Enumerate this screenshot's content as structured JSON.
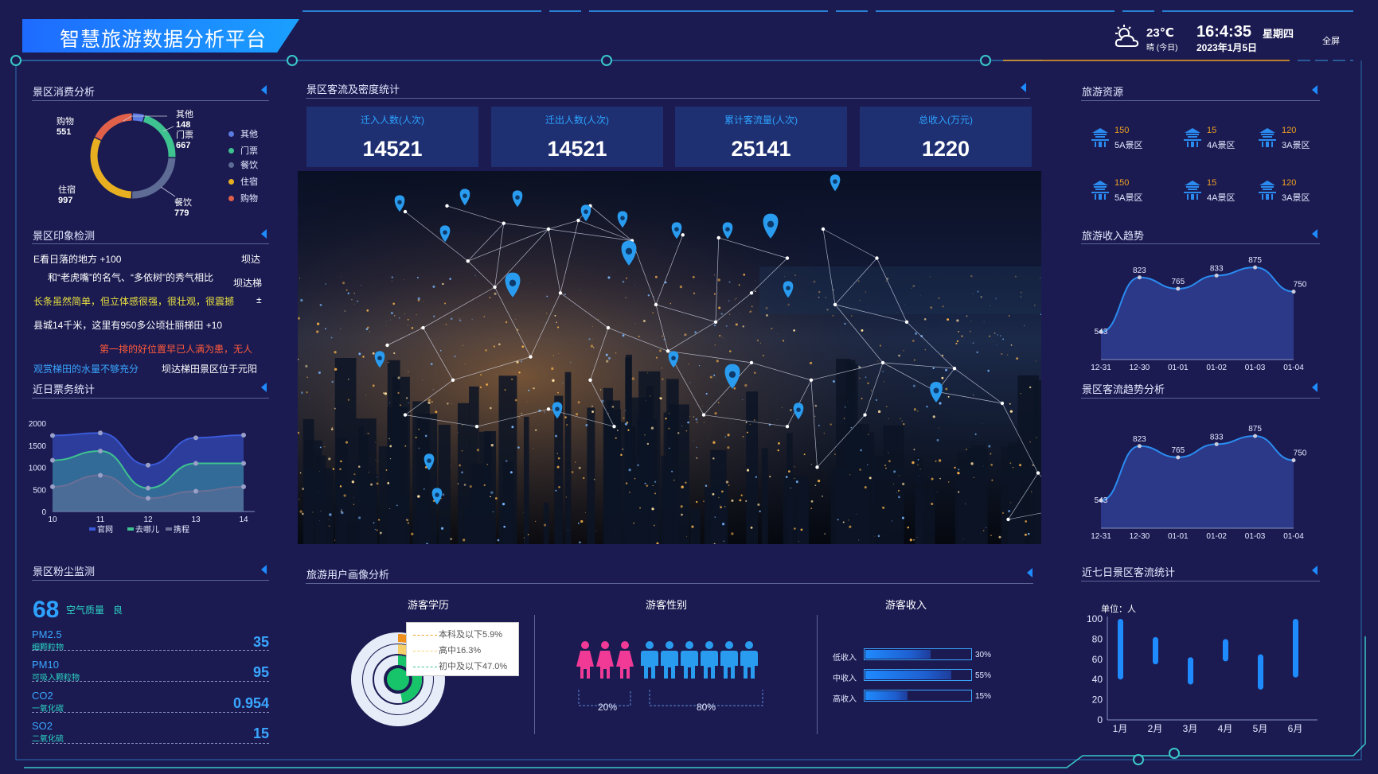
{
  "header": {
    "title": "智慧旅游数据分析平台",
    "temperature": "23℃",
    "weather_desc": "晴 (今日)",
    "time": "16:4:35",
    "weekday": "星期四",
    "date": "2023年1月5日",
    "fullscreen_label": "全屏"
  },
  "sections": {
    "consumption": "景区消费分析",
    "impression": "景区印象检测",
    "tickets": "近日票务统计",
    "dust": "景区粉尘监测",
    "flow_density": "景区客流及密度统计",
    "portrait": "旅游用户画像分析",
    "resources": "旅游资源",
    "income_trend": "旅游收入趋势",
    "flow_trend": "景区客流趋势分析",
    "seven_day": "近七日景区客流统计"
  },
  "consumption": {
    "legend": [
      {
        "name": "其他",
        "value": "148",
        "color": "#5b7be0"
      },
      {
        "name": "门票",
        "value": "667",
        "color": "#3ec28f"
      },
      {
        "name": "餐饮",
        "value": "779",
        "color": "#5e6b94"
      },
      {
        "name": "住宿",
        "value": "997",
        "color": "#e8b020"
      },
      {
        "name": "购物",
        "value": "551",
        "color": "#e0604a"
      }
    ]
  },
  "impression": {
    "lines": [
      {
        "text": "E看日落的地方  +100",
        "color": "#ffffff"
      },
      {
        "text": "坝达",
        "color": "#ffffff"
      },
      {
        "text": "和“老虎嘴”的名气、“多依树”的秀气相比",
        "color": "#ffffff"
      },
      {
        "text": "坝达梯",
        "color": "#ffffff"
      },
      {
        "text": "长条虽然简单，但立体感很强，很壮观，很震撼",
        "color": "#e8e040"
      },
      {
        "text": "±",
        "color": "#ffffff"
      },
      {
        "text": "县城14千米，这里有950多公顷壮丽梯田  +10",
        "color": "#ffffff"
      },
      {
        "text": "第一排的好位置早已人满为患，无人",
        "color": "#ff5a3a"
      },
      {
        "text": "观赏梯田的水量不够充分",
        "color": "#3aa6ff"
      },
      {
        "text": "坝达梯田景区位于元阳",
        "color": "#ffffff"
      }
    ]
  },
  "tickets": {
    "legend": [
      "官网",
      "去哪儿",
      "携程"
    ],
    "y_ticks": [
      "2000",
      "1500",
      "1000",
      "500",
      "0"
    ],
    "x_ticks": [
      "10",
      "11",
      "12",
      "13",
      "14"
    ]
  },
  "dust": {
    "aqi_value": "68",
    "aqi_label": "空气质量",
    "aqi_level": "良",
    "items": [
      {
        "name": "PM2.5",
        "sub": "细颗粒物",
        "value": "35"
      },
      {
        "name": "PM10",
        "sub": "可吸入颗粒物",
        "value": "95"
      },
      {
        "name": "CO2",
        "sub": "一氧化碳",
        "value": "0.954"
      },
      {
        "name": "SO2",
        "sub": "二氧化硫",
        "value": "15"
      }
    ]
  },
  "stats": [
    {
      "label": "迁入人数(人次)",
      "value": "14521"
    },
    {
      "label": "迁出人数(人次)",
      "value": "14521"
    },
    {
      "label": "累计客流量(人次)",
      "value": "25141"
    },
    {
      "label": "总收入(万元)",
      "value": "1220"
    }
  ],
  "portrait": {
    "education_title": "游客学历",
    "education_legend": [
      "本科及以下5.9%",
      "高中16.3%",
      "初中及以下47.0%"
    ],
    "education_values": [
      5.9,
      16.3,
      47.0
    ],
    "gender_title": "游客性别",
    "gender_female": "20%",
    "gender_male": "80%",
    "income_title": "游客收入",
    "income_rows": [
      {
        "label": "低收入",
        "pct": "30%",
        "fill": 0.62
      },
      {
        "label": "中收入",
        "pct": "55%",
        "fill": 0.82
      },
      {
        "label": "高收入",
        "pct": "15%",
        "fill": 0.4
      }
    ]
  },
  "resources": {
    "items": [
      {
        "num": "150",
        "label": "5A景区"
      },
      {
        "num": "15",
        "label": "4A景区"
      },
      {
        "num": "120",
        "label": "3A景区"
      },
      {
        "num": "150",
        "label": "5A景区"
      },
      {
        "num": "15",
        "label": "4A景区"
      },
      {
        "num": "120",
        "label": "3A景区"
      }
    ]
  },
  "seven_day": {
    "unit": "单位：人"
  },
  "chart_data": [
    {
      "type": "pie",
      "title": "",
      "categories": [
        "其他",
        "门票",
        "餐饮",
        "住宿",
        "购物"
      ],
      "values": [
        148,
        667,
        779,
        997,
        551
      ]
    },
    {
      "type": "area",
      "title": "",
      "x": [
        10,
        11,
        12,
        13,
        14
      ],
      "ylim": [
        0,
        2000
      ],
      "series": [
        {
          "name": "官网",
          "values": [
            1720,
            1780,
            1050,
            1670,
            1730
          ]
        },
        {
          "name": "去哪儿",
          "values": [
            1160,
            1370,
            530,
            1090,
            1090
          ]
        },
        {
          "name": "携程",
          "values": [
            560,
            820,
            300,
            460,
            560
          ]
        }
      ]
    },
    {
      "type": "area",
      "title": "",
      "categories": [
        "12-31",
        "12-30",
        "01-01",
        "01-02",
        "01-03",
        "01-04"
      ],
      "values": [
        543,
        823,
        765,
        833,
        875,
        750
      ],
      "data_labels": [
        "543",
        "823",
        "765",
        "833",
        "875",
        "750"
      ]
    },
    {
      "type": "area",
      "title": "",
      "categories": [
        "12-31",
        "12-30",
        "01-01",
        "01-02",
        "01-03",
        "01-04"
      ],
      "values": [
        543,
        823,
        765,
        833,
        875,
        750
      ],
      "data_labels": [
        "543",
        "823",
        "765",
        "833",
        "875",
        "750"
      ]
    },
    {
      "type": "bar",
      "title": "",
      "categories": [
        "1月",
        "2月",
        "3月",
        "4月",
        "5月",
        "6月"
      ],
      "ylim": [
        0,
        100
      ],
      "y_ticks": [
        "100",
        "80",
        "60",
        "40",
        "20",
        "0"
      ],
      "ranges": [
        [
          40,
          100
        ],
        [
          55,
          82
        ],
        [
          35,
          62
        ],
        [
          58,
          80
        ],
        [
          30,
          65
        ],
        [
          42,
          100
        ]
      ]
    }
  ],
  "colors": {
    "background": "#1b1b52",
    "accent": "#1e8bff",
    "panel": "#1e2f72",
    "orange": "#f0a020"
  }
}
